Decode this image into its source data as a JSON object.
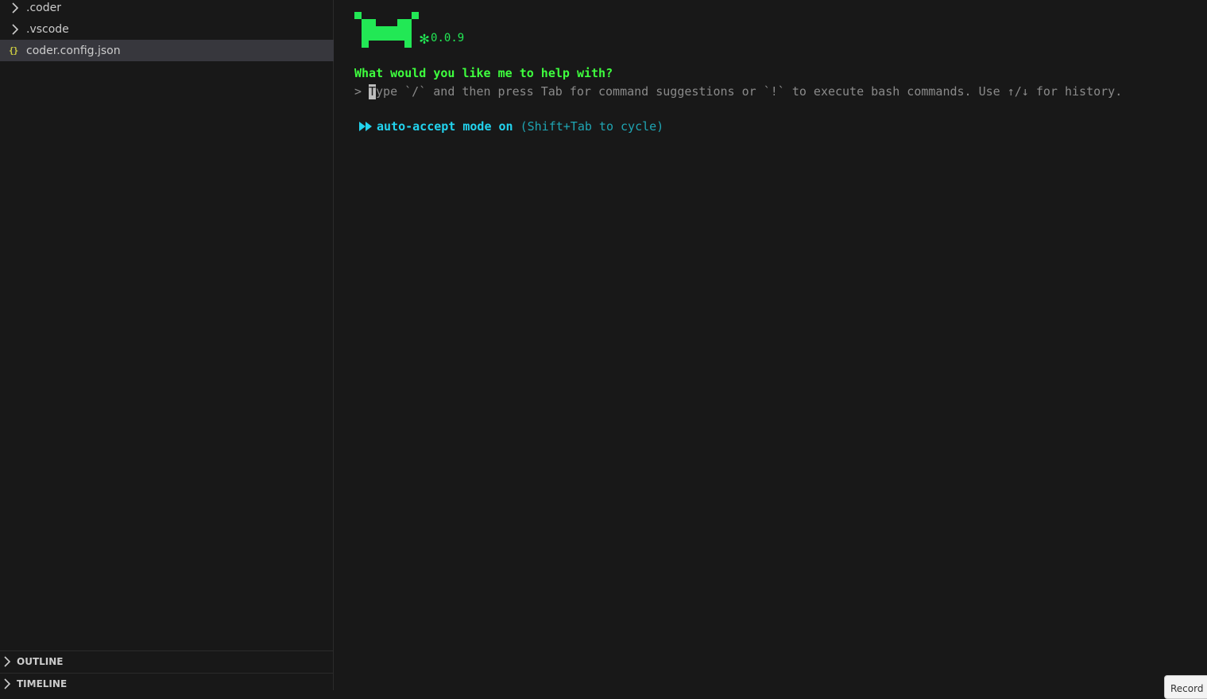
{
  "explorer": {
    "items": [
      {
        "label": ".coder",
        "kind": "folder",
        "icon": "chevron-right-icon"
      },
      {
        "label": ".vscode",
        "kind": "folder",
        "icon": "chevron-right-icon"
      },
      {
        "label": "coder.config.json",
        "kind": "file",
        "icon": "json-file-icon",
        "icon_glyph": "{}",
        "selected": true
      }
    ],
    "sections": [
      {
        "label": "OUTLINE",
        "icon": "chevron-right-icon"
      },
      {
        "label": "TIMELINE",
        "icon": "chevron-right-icon"
      }
    ]
  },
  "terminal": {
    "logo_icon": "pixel-alien-icon",
    "version_symbol": "✻",
    "version": "0.0.9",
    "question": "What would you like me to help with?",
    "prompt_symbol": ">",
    "input_value": "",
    "input_cursor_char": "T",
    "input_placeholder": "ype `/` and then press Tab for command suggestions or `!` to execute bash commands. Use ↑/↓ for history.",
    "mode_icon": "fast-forward-icon",
    "mode_label": "auto-accept mode on",
    "mode_hint": "(Shift+Tab to cycle)"
  },
  "tooltip": {
    "label": "Record"
  },
  "colors": {
    "background": "#181818",
    "selected_row": "#37373d",
    "logo_green": "#22e855",
    "question_green": "#3eff3e",
    "mode_cyan": "#22d3ee",
    "muted_text": "#8a8a8a"
  }
}
